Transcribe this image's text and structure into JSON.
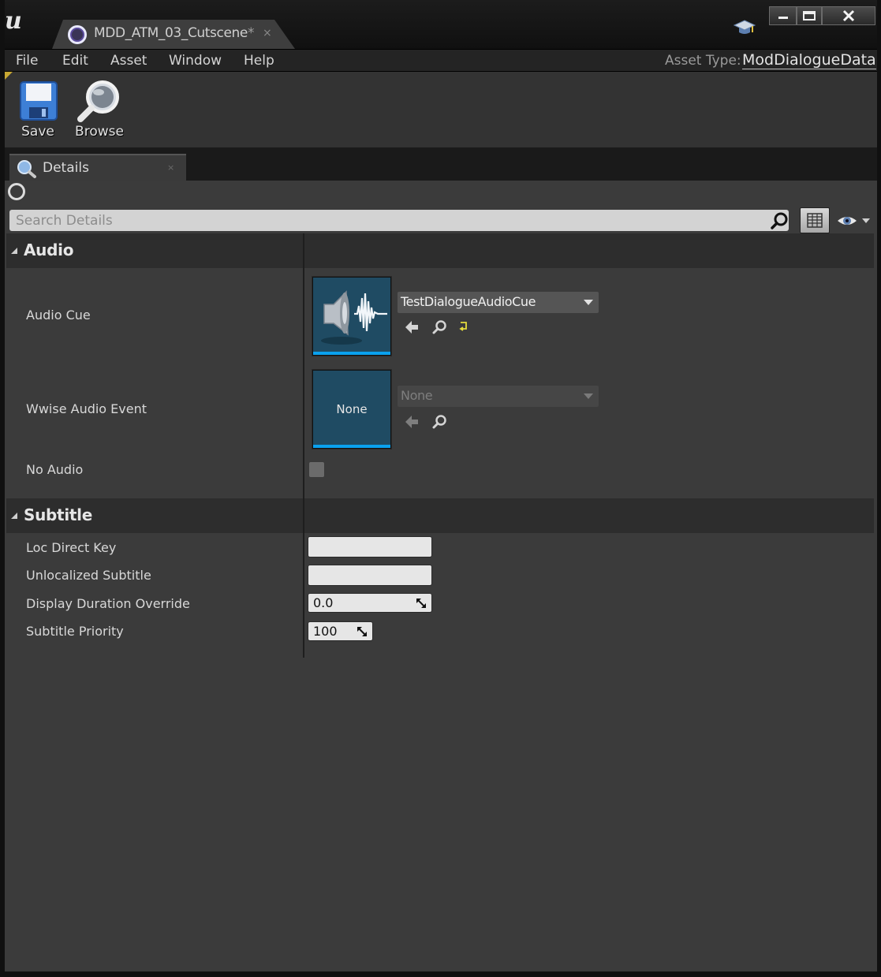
{
  "window": {
    "tab_title": "MDD_ATM_03_Cutscene",
    "tab_modified": "*",
    "close_glyph": "×",
    "logo": "u"
  },
  "menu": {
    "items": [
      "File",
      "Edit",
      "Asset",
      "Window",
      "Help"
    ],
    "asset_type_label": "Asset Type:",
    "asset_type_value": "ModDialogueData"
  },
  "toolbar": {
    "save_label": "Save",
    "browse_label": "Browse"
  },
  "details_tab": {
    "label": "Details"
  },
  "search": {
    "placeholder": "Search Details"
  },
  "categories": {
    "audio": {
      "label": "Audio",
      "audio_cue": {
        "label": "Audio Cue",
        "value": "TestDialogueAudioCue"
      },
      "wwise_audio_event": {
        "label": "Wwise Audio Event",
        "value": "None",
        "thumbnail_text": "None"
      },
      "no_audio": {
        "label": "No Audio",
        "checked": false
      }
    },
    "subtitle": {
      "label": "Subtitle",
      "loc_direct_key": {
        "label": "Loc Direct Key",
        "value": ""
      },
      "unlocalized_subtitle": {
        "label": "Unlocalized Subtitle",
        "value": ""
      },
      "display_duration_override": {
        "label": "Display Duration Override",
        "value": "0.0"
      },
      "subtitle_priority": {
        "label": "Subtitle Priority",
        "value": "100"
      }
    }
  },
  "colors": {
    "panel_bg": "#3b3b3b",
    "category_bg": "#2d2d2d",
    "thumbnail_bg": "#1f4b63",
    "thumbnail_accent": "#0aa1ee"
  }
}
